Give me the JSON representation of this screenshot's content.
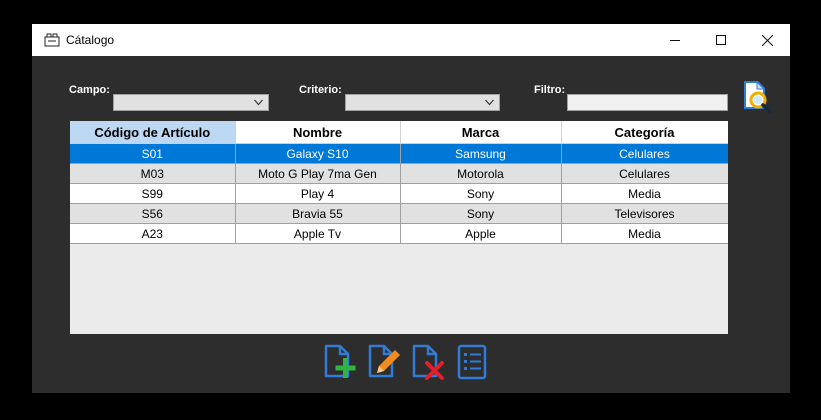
{
  "window": {
    "title": "Cátalogo"
  },
  "filters": {
    "campo_label": "Campo:",
    "criterio_label": "Criterio:",
    "filtro_label": "Filtro:",
    "campo_value": "",
    "criterio_value": "",
    "filtro_value": ""
  },
  "table": {
    "columns": [
      "Código de Artículo",
      "Nombre",
      "Marca",
      "Categoría"
    ],
    "rows": [
      [
        "S01",
        "Galaxy S10",
        "Samsung",
        "Celulares"
      ],
      [
        "M03",
        "Moto G Play 7ma Gen",
        "Motorola",
        "Celulares"
      ],
      [
        "S99",
        "Play 4",
        "Sony",
        "Media"
      ],
      [
        "S56",
        "Bravia 55",
        "Sony",
        "Televisores"
      ],
      [
        "A23",
        "Apple Tv",
        "Apple",
        "Media"
      ]
    ],
    "selected_row": 0
  },
  "icons": {
    "app": "catalog-icon",
    "search": "search-document-icon",
    "add": "add-document-icon",
    "edit": "edit-document-icon",
    "delete": "delete-document-icon",
    "list": "list-icon"
  },
  "colors": {
    "window_bg": "#2d2d2d",
    "selection": "#0078d7",
    "icon_blue": "#2f7bd6",
    "add_green": "#2fb344",
    "edit_orange": "#f28a1c",
    "delete_red": "#e0202a"
  }
}
